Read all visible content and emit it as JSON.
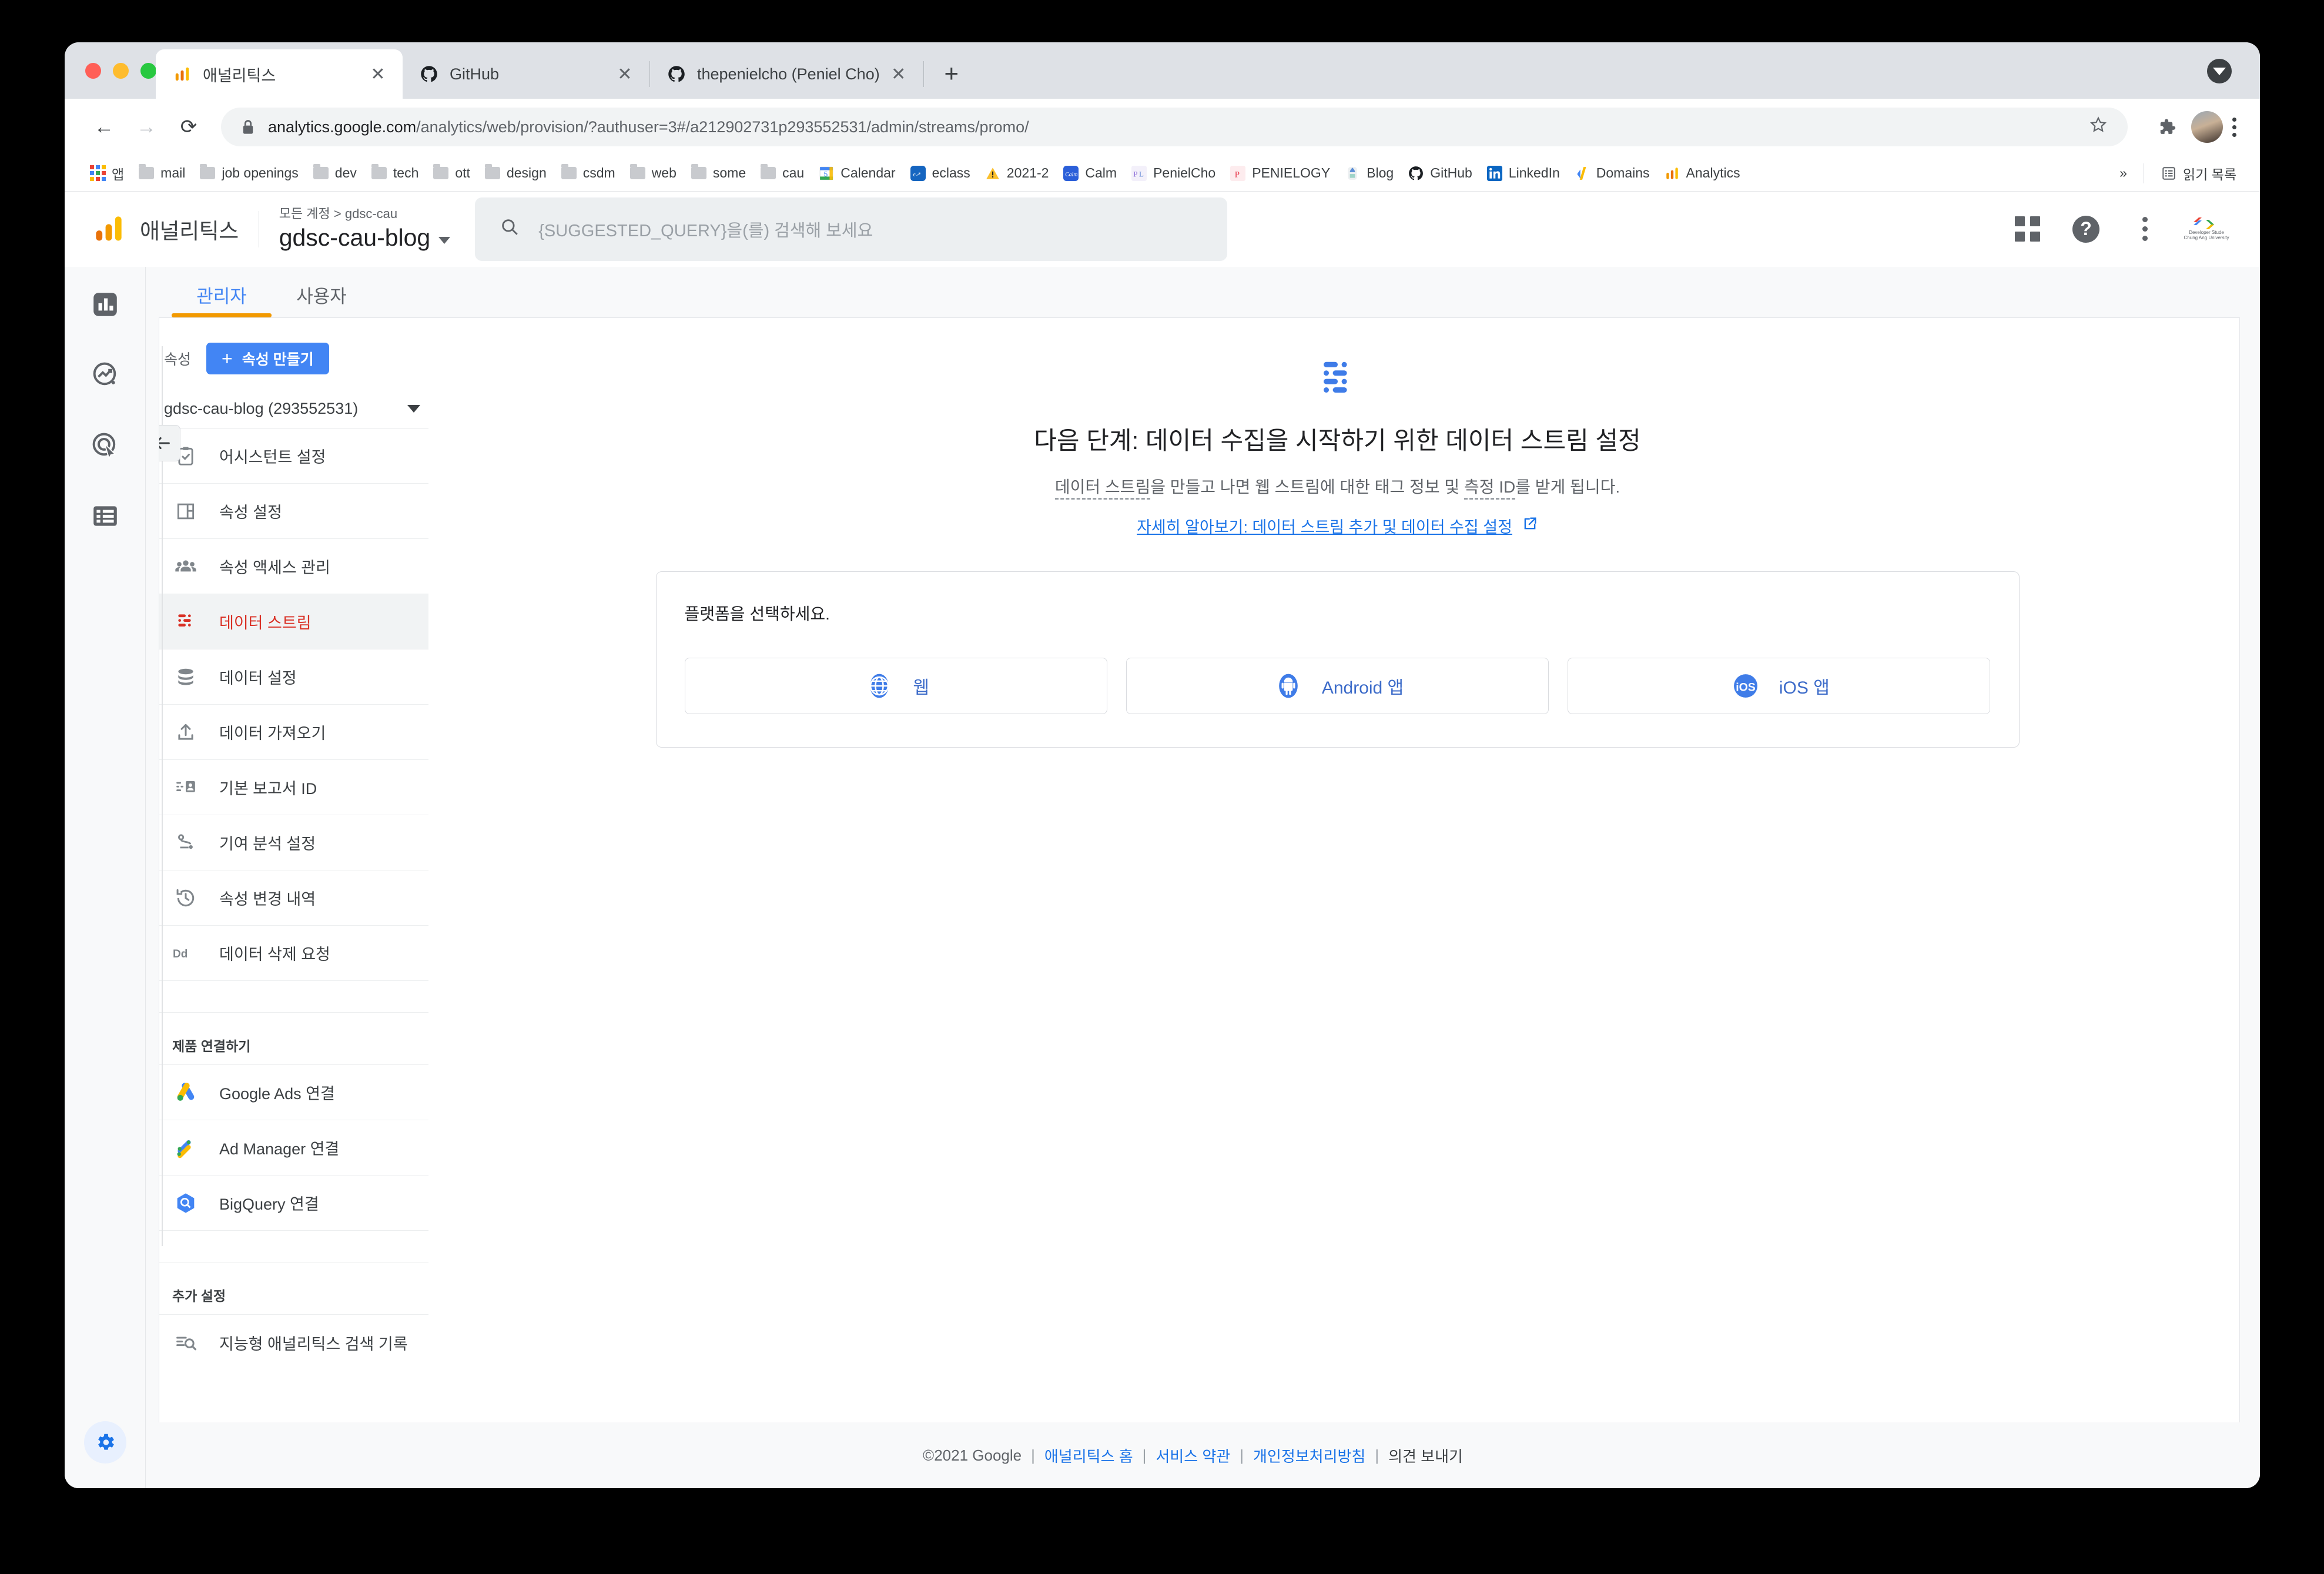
{
  "browser": {
    "tabs": [
      {
        "title": "애널리틱스",
        "favicon": "analytics-icon",
        "active": true
      },
      {
        "title": "GitHub",
        "favicon": "github-icon",
        "active": false
      },
      {
        "title": "thepenielcho (Peniel Cho)",
        "favicon": "github-icon",
        "active": false
      }
    ],
    "new_tab_label": "+",
    "close_label": "✕",
    "nav": {
      "back": "←",
      "forward": "→",
      "reload": "⟳"
    },
    "omnibox": {
      "lock_icon": "lock-icon",
      "domain": "analytics.google.com",
      "path": "/analytics/web/provision/?authuser=3#/a212902731p293552531/admin/streams/promo/",
      "star_icon": "star-icon",
      "extensions_icon": "puzzle-icon",
      "profile_icon": "profile-avatar",
      "menu_icon": "kebab-menu-icon"
    },
    "bookmarks": [
      {
        "label": "앱",
        "icon": "apps-grid-icon"
      },
      {
        "label": "mail",
        "icon": "folder-icon"
      },
      {
        "label": "job openings",
        "icon": "folder-icon"
      },
      {
        "label": "dev",
        "icon": "folder-icon"
      },
      {
        "label": "tech",
        "icon": "folder-icon"
      },
      {
        "label": "ott",
        "icon": "folder-icon"
      },
      {
        "label": "design",
        "icon": "folder-icon"
      },
      {
        "label": "csdm",
        "icon": "folder-icon"
      },
      {
        "label": "web",
        "icon": "folder-icon"
      },
      {
        "label": "some",
        "icon": "folder-icon"
      },
      {
        "label": "cau",
        "icon": "folder-icon"
      },
      {
        "label": "Calendar",
        "icon": "calendar-icon"
      },
      {
        "label": "eclass",
        "icon": "eclass-icon"
      },
      {
        "label": "2021-2",
        "icon": "warning-icon"
      },
      {
        "label": "Calm",
        "icon": "calm-icon"
      },
      {
        "label": "PenielCho",
        "icon": "penielcho-icon"
      },
      {
        "label": "PENIELOGY",
        "icon": "penielogy-icon"
      },
      {
        "label": "Blog",
        "icon": "blog-icon"
      },
      {
        "label": "GitHub",
        "icon": "github-icon"
      },
      {
        "label": "LinkedIn",
        "icon": "linkedin-icon"
      },
      {
        "label": "Domains",
        "icon": "domains-icon"
      },
      {
        "label": "Analytics",
        "icon": "analytics-icon"
      }
    ],
    "bookmarks_overflow": "»",
    "reading_list": {
      "label": "읽기 목록",
      "icon": "reading-list-icon"
    }
  },
  "ga": {
    "brand": "애널리틱스",
    "breadcrumb": "모든 계정 > gdsc-cau",
    "property_name": "gdsc-cau-blog",
    "search": {
      "placeholder": "{SUGGESTED_QUERY}을(를) 검색해 보세요",
      "icon": "search-icon"
    },
    "header_icons": {
      "apps": "apps-grid-icon",
      "help": "help-icon",
      "more": "kebab-menu-icon",
      "avatar": "gdsc-cau-avatar",
      "avatar_line1": "Developer Stude",
      "avatar_line2": "Chung Ang University"
    },
    "rail": [
      {
        "name": "reports-icon"
      },
      {
        "name": "explore-icon"
      },
      {
        "name": "advertising-icon"
      },
      {
        "name": "configure-icon"
      },
      {
        "name": "admin-gear-icon"
      }
    ],
    "tabs": [
      {
        "label": "관리자",
        "active": true
      },
      {
        "label": "사용자",
        "active": false
      }
    ],
    "admin": {
      "property_label": "속성",
      "create_button": "속성 만들기",
      "create_plus": "+",
      "property_selector": "gdsc-cau-blog (293552531)",
      "items": [
        {
          "label": "어시스턴트 설정",
          "icon": "clipboard-check-icon",
          "active": false
        },
        {
          "label": "속성 설정",
          "icon": "layout-icon",
          "active": false
        },
        {
          "label": "속성 액세스 관리",
          "icon": "people-icon",
          "active": false
        },
        {
          "label": "데이터 스트림",
          "icon": "data-stream-icon",
          "active": true
        },
        {
          "label": "데이터 설정",
          "icon": "database-icon",
          "active": false
        },
        {
          "label": "데이터 가져오기",
          "icon": "upload-icon",
          "active": false
        },
        {
          "label": "기본 보고서 ID",
          "icon": "reporting-identity-icon",
          "active": false
        },
        {
          "label": "기여 분석 설정",
          "icon": "attribution-icon",
          "active": false
        },
        {
          "label": "속성 변경 내역",
          "icon": "history-icon",
          "active": false
        },
        {
          "label": "데이터 삭제 요청",
          "icon": "data-deletion-icon",
          "active": false
        }
      ],
      "section_products": "제품 연결하기",
      "product_items": [
        {
          "label": "Google Ads 연결",
          "icon": "google-ads-icon"
        },
        {
          "label": "Ad Manager 연결",
          "icon": "ad-manager-icon"
        },
        {
          "label": "BigQuery 연결",
          "icon": "bigquery-icon"
        }
      ],
      "section_additional": "추가 설정",
      "additional_items": [
        {
          "label": "지능형 애널리틱스 검색 기록",
          "icon": "search-history-icon"
        }
      ],
      "collapse_icon": "arrow-left-icon"
    },
    "main": {
      "glyph": "data-stream-icon",
      "title": "다음 단계: 데이터 수집을 시작하기 위한 데이터 스트림 설정",
      "subtitle_part1": "데이터 스트림",
      "subtitle_part2": "을 만들고 나면 웹 스트림에 대한 태그 정보 및 ",
      "subtitle_part3": "측정 ID",
      "subtitle_part4": "를 받게 됩니다.",
      "learn_more": "자세히 알아보기: 데이터 스트림 추가 및 데이터 수집 설정",
      "learn_more_icon": "external-link-icon",
      "platform_prompt": "플랫폼을 선택하세요.",
      "platforms": [
        {
          "label": "웹",
          "icon": "globe-icon"
        },
        {
          "label": "Android 앱",
          "icon": "android-icon"
        },
        {
          "label": "iOS 앱",
          "icon": "ios-icon"
        }
      ]
    },
    "footer": {
      "copyright": "©2021 Google",
      "links": [
        "애널리틱스 홈",
        "서비스 약관",
        "개인정보처리방침"
      ],
      "feedback": "의견 보내기"
    }
  },
  "colors": {
    "accent_blue": "#1a73e8",
    "active_red": "#d93025",
    "tab_underline_orange": "#f29900",
    "button_blue": "#4285f4"
  }
}
